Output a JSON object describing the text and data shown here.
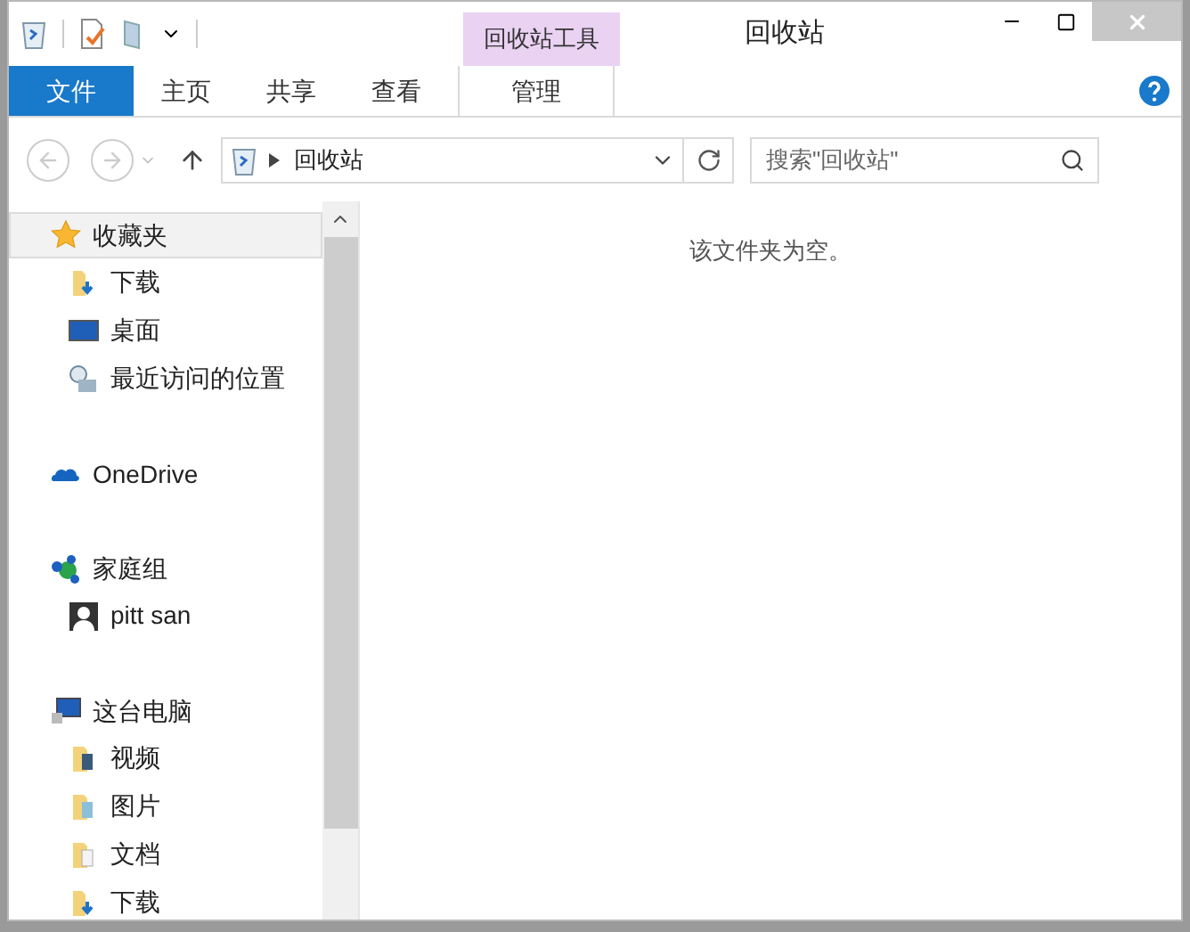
{
  "window": {
    "title": "回收站",
    "context_tab": "回收站工具"
  },
  "ribbon_tabs": [
    {
      "label": "文件",
      "kind": "file",
      "selected": false
    },
    {
      "label": "主页",
      "kind": "tab",
      "selected": false
    },
    {
      "label": "共享",
      "kind": "tab",
      "selected": false
    },
    {
      "label": "查看",
      "kind": "tab",
      "selected": false
    },
    {
      "label": "管理",
      "kind": "context",
      "selected": false
    }
  ],
  "address": {
    "path": "回收站"
  },
  "search": {
    "placeholder": "搜索\"回收站\""
  },
  "nav": [
    {
      "label": "收藏夹",
      "kind": "star",
      "selected": true,
      "children": [
        {
          "label": "下载",
          "kind": "download"
        },
        {
          "label": "桌面",
          "kind": "desktop"
        },
        {
          "label": "最近访问的位置",
          "kind": "recent"
        }
      ]
    },
    {
      "label": "OneDrive",
      "kind": "cloud",
      "selected": false
    },
    {
      "label": "家庭组",
      "kind": "homegroup",
      "selected": false,
      "children": [
        {
          "label": "pitt san",
          "kind": "user"
        }
      ]
    },
    {
      "label": "这台电脑",
      "kind": "computer",
      "selected": false,
      "children": [
        {
          "label": "视频",
          "kind": "videos"
        },
        {
          "label": "图片",
          "kind": "pictures"
        },
        {
          "label": "文档",
          "kind": "documents"
        },
        {
          "label": "下载",
          "kind": "download"
        }
      ]
    }
  ],
  "content": {
    "empty_message": "该文件夹为空。"
  }
}
